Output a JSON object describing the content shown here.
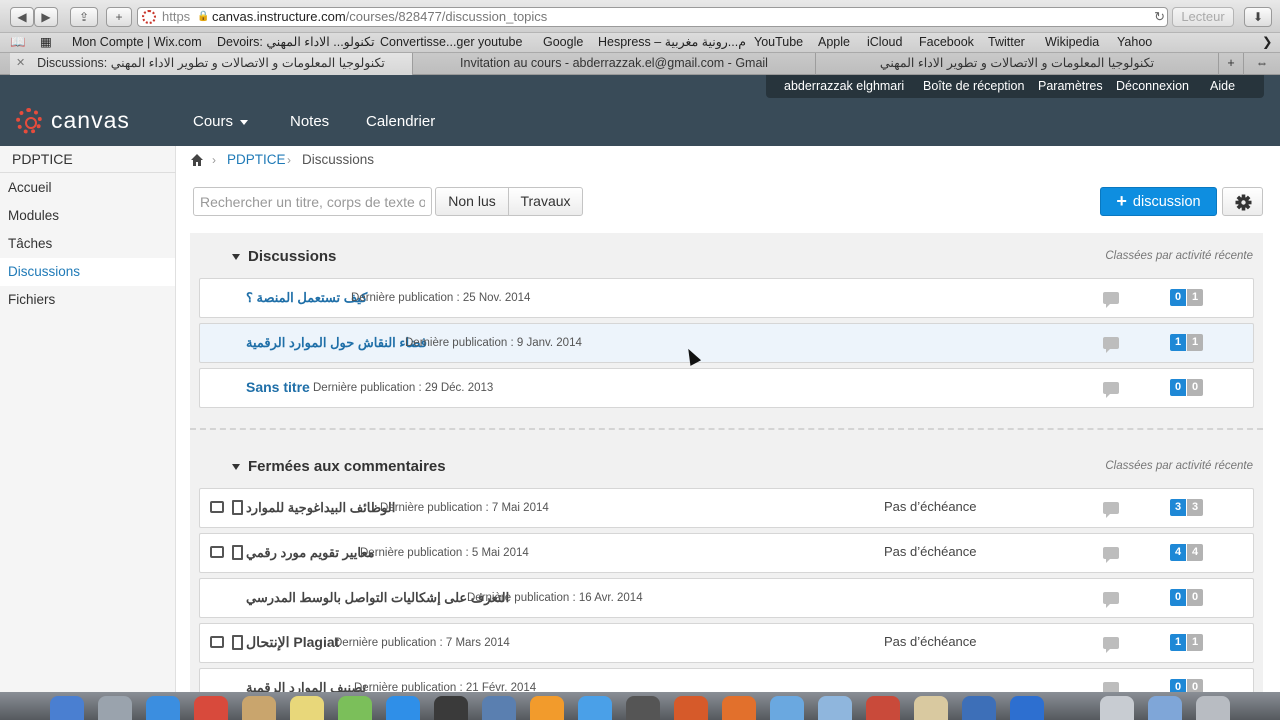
{
  "browser": {
    "url_scheme": "https",
    "url_host": "canvas.instructure.com",
    "url_path": "/courses/828477/discussion_topics",
    "reader_label": "Lecteur",
    "bookmarks": [
      "Mon Compte | Wix.com",
      "Devoirs: تكنولو... الاداء المهني",
      "Convertisse...ger youtube",
      "Google",
      "Hespress – م...رونية مغربية",
      "YouTube",
      "Apple",
      "iCloud",
      "Facebook",
      "Twitter",
      "Wikipedia",
      "Yahoo"
    ],
    "tabs": [
      {
        "label": "Discussions: تكنولوجيا المعلومات و الاتصالات و تطوير الاداء المهني"
      },
      {
        "label": "Invitation au cours - abderrazzak.el@gmail.com - Gmail"
      },
      {
        "label": "تكنولوجيا المعلومات و الاتصالات و تطوير الاداء المهني"
      }
    ]
  },
  "userbar": {
    "user_name": "abderrazzak elghmari",
    "inbox": "Boîte de réception",
    "settings": "Paramètres",
    "logout": "Déconnexion",
    "help": "Aide"
  },
  "header": {
    "logo_text": "canvas",
    "nav": {
      "courses": "Cours",
      "grades": "Notes",
      "calendar": "Calendrier"
    }
  },
  "sidebar": {
    "course_code": "PDPTICE",
    "items": [
      {
        "label": "Accueil"
      },
      {
        "label": "Modules"
      },
      {
        "label": "Tâches"
      },
      {
        "label": "Discussions"
      },
      {
        "label": "Fichiers"
      }
    ]
  },
  "breadcrumb": {
    "course": "PDPTICE",
    "current": "Discussions"
  },
  "toolbar": {
    "search_placeholder": "Rechercher un titre, corps de texte o",
    "filter_unread": "Non lus",
    "filter_graded": "Travaux",
    "new_discussion": "discussion"
  },
  "sections": {
    "open": {
      "title": "Discussions",
      "sort_note": "Classées par activité récente",
      "rows": [
        {
          "title": "كيف تستعمل المنصة ؟",
          "meta": "Dernière publication : 25 Nov. 2014",
          "unread": "0",
          "total": "1"
        },
        {
          "title": "فضاء النقاش حول الموارد الرقمية",
          "meta": "Dernière publication : 9 Janv. 2014",
          "unread": "1",
          "total": "1"
        },
        {
          "title": "Sans titre",
          "meta": "Dernière publication : 29 Déc. 2013",
          "unread": "0",
          "total": "0"
        }
      ]
    },
    "closed": {
      "title": "Fermées aux commentaires",
      "sort_note": "Classées par activité récente",
      "rows": [
        {
          "title": "الوظائف البيداغوجية للموارد",
          "meta": "Dernière publication : 7 Mai 2014",
          "due": "Pas d’échéance",
          "unread": "3",
          "total": "3"
        },
        {
          "title": "معايير تقويم مورد رقمي",
          "meta": "Dernière publication : 5 Mai 2014",
          "due": "Pas d’échéance",
          "unread": "4",
          "total": "4"
        },
        {
          "title": "التعرف على إشكاليات التواصل بالوسط المدرسي",
          "meta": "Dernière publication : 16 Avr. 2014",
          "unread": "0",
          "total": "0"
        },
        {
          "title": "الإنتحال Plagiat",
          "meta": "Dernière publication : 7 Mars 2014",
          "due": "Pas d’échéance",
          "unread": "1",
          "total": "1"
        },
        {
          "title": "تصنيف الموارد الرقمية",
          "meta": "Dernière publication : 21 Févr. 2014",
          "unread": "0",
          "total": "0"
        }
      ]
    }
  },
  "colors": {
    "header_bg": "#394b58",
    "accent": "#0e8ee0",
    "link": "#1f7ab7",
    "unread_badge": "#1e88d6"
  }
}
